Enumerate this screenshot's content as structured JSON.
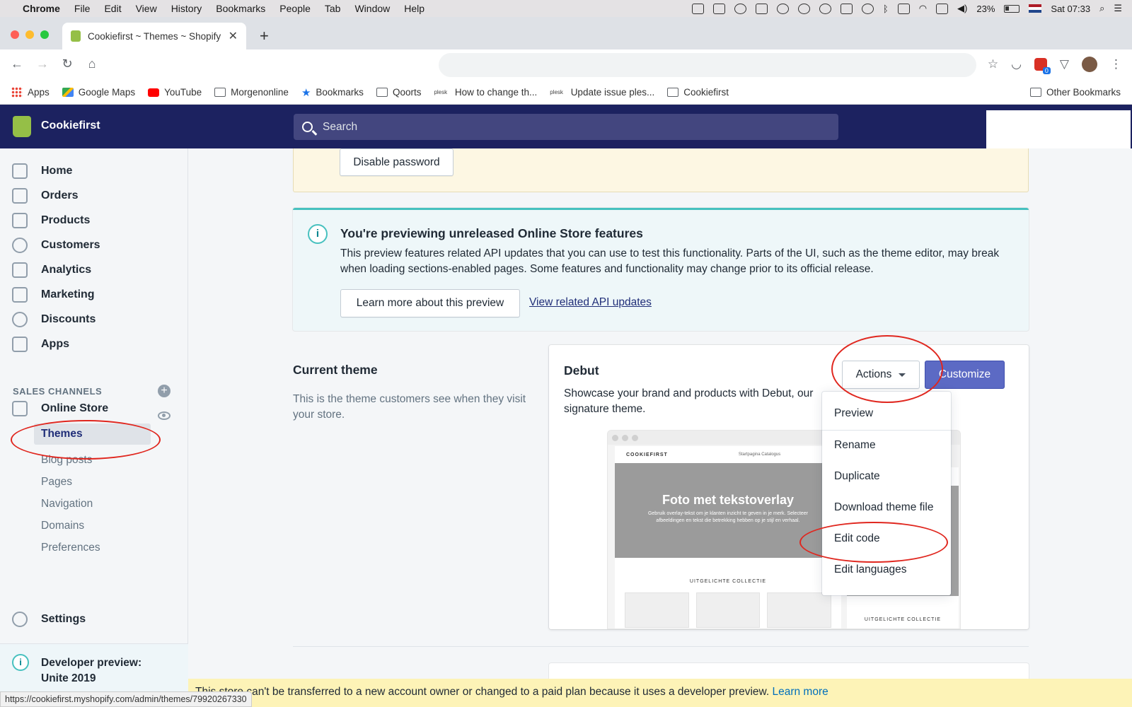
{
  "macos": {
    "app_name": "Chrome",
    "menus": [
      "File",
      "Edit",
      "View",
      "History",
      "Bookmarks",
      "People",
      "Tab",
      "Window",
      "Help"
    ],
    "battery": "23%",
    "clock": "Sat 07:33"
  },
  "browser": {
    "tab_title": "Cookiefirst ~ Themes ~ Shopify",
    "extension_badge": "0",
    "bookmarks": [
      {
        "label": "Apps",
        "icon": "apps-grid-icon"
      },
      {
        "label": "Google Maps",
        "icon": "google-maps-icon"
      },
      {
        "label": "YouTube",
        "icon": "youtube-icon"
      },
      {
        "label": "Morgenonline",
        "icon": "folder-icon"
      },
      {
        "label": "Bookmarks",
        "icon": "star-icon"
      },
      {
        "label": "Qoorts",
        "icon": "folder-icon"
      },
      {
        "label": "How to change th...",
        "icon": "plesk-icon"
      },
      {
        "label": "Update issue ples...",
        "icon": "plesk-icon"
      },
      {
        "label": "Cookiefirst",
        "icon": "folder-icon"
      }
    ],
    "other_bookmarks": "Other Bookmarks",
    "status_url": "https://cookiefirst.myshopify.com/admin/themes/79920267330"
  },
  "shopify": {
    "store_name": "Cookiefirst",
    "search_placeholder": "Search"
  },
  "sidebar": {
    "items": [
      {
        "label": "Home",
        "icon": "home-icon"
      },
      {
        "label": "Orders",
        "icon": "orders-icon"
      },
      {
        "label": "Products",
        "icon": "tag-icon"
      },
      {
        "label": "Customers",
        "icon": "person-icon"
      },
      {
        "label": "Analytics",
        "icon": "bar-chart-icon"
      },
      {
        "label": "Marketing",
        "icon": "megaphone-icon"
      },
      {
        "label": "Discounts",
        "icon": "discount-icon"
      },
      {
        "label": "Apps",
        "icon": "apps-icon"
      }
    ],
    "sales_channels_title": "SALES CHANNELS",
    "online_store": "Online Store",
    "subitems": [
      "Themes",
      "Blog posts",
      "Pages",
      "Navigation",
      "Domains",
      "Preferences"
    ],
    "settings": "Settings",
    "dev_preview": "Developer preview: Unite 2019"
  },
  "main": {
    "disable_password": "Disable password",
    "preview_banner": {
      "title": "You're previewing unreleased Online Store features",
      "body": "This preview features related API updates that you can use to test this functionality. Parts of the UI, such as the theme editor, may break when loading sections-enabled pages. Some features and functionality may change prior to its official release.",
      "learn_more": "Learn more about this preview",
      "api_link": "View related API updates"
    },
    "current_theme": {
      "title": "Current theme",
      "desc": "This is the theme customers see when they visit your store."
    },
    "theme": {
      "name": "Debut",
      "desc": "Showcase your brand and products with Debut, our signature theme.",
      "actions": "Actions",
      "customize": "Customize"
    },
    "mockup": {
      "brand": "COOKIEFIRST",
      "nav_links": "Startpagina   Catalogus",
      "hero_title": "Foto met tekstoverlay",
      "hero_sub": "Gebruik overlay-tekst om je klanten inzicht te geven in je merk. Selecteer afbeeldingen en tekst die betrekking hebben op je stijl en verhaal.",
      "collection": "UITGELICHTE COLLECTIE",
      "side_collection": "UITGELICHTE COLLECTIE"
    },
    "dropdown": [
      "Preview",
      "Rename",
      "Duplicate",
      "Download theme file",
      "Edit code",
      "Edit languages"
    ]
  },
  "bottom_banner": {
    "text": "This store can't be transferred to a new account owner or changed to a paid plan because it uses a developer preview. ",
    "link": "Learn more"
  },
  "colors": {
    "shopify_topbar": "#1c2260",
    "customize_button": "#5c6ac4",
    "annotation_red": "#e0271f",
    "teal_accent": "#47c1bf"
  }
}
